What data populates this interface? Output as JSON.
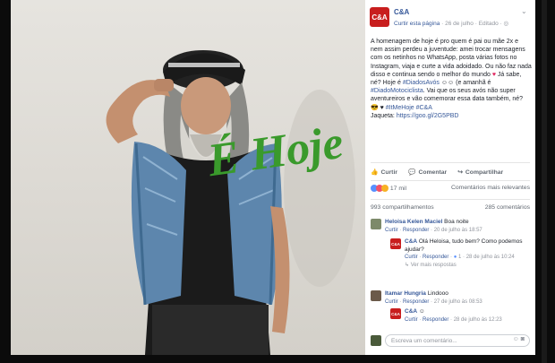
{
  "page": {
    "name": "C&A",
    "logo_text": "C&A",
    "follow_label": "Curtir esta página",
    "date": "26 de julho",
    "edited": "Editado",
    "globe_icon": "globe-icon"
  },
  "photo": {
    "overlay_text": "É Hoje",
    "overlay_color": "#3a9a2c"
  },
  "post": {
    "text_1": "A homenagem de hoje é pro quem é pai ou mãe 2x e nem assim perdeu a juventude: amei trocar mensagens com os netinhos no WhatsApp, posta várias fotos no Instagram, viaja e curte a vida adoidado. Ou não faz nada disso e continua sendo o melhor do mundo ",
    "text_2": " Já sabe, né? Hoje é ",
    "hashtag_1": "#DiadosAvós",
    "text_3": " (e amanhã é ",
    "hashtag_2": "#DiadoMotociclista",
    "text_4": ". Vai que os seus avós não super aventureiros e vão comemorar essa data também, né?",
    "hashtag_3": "#ItMeHoje #C&A",
    "jacket_label": "Jaqueta: ",
    "jacket_link": "https://goo.gl/2G5PBD"
  },
  "actions": {
    "like": "Curtir",
    "comment": "Comentar",
    "share": "Compartilhar"
  },
  "reactions": {
    "count": "17 mil",
    "sort_label": "Comentários mais relevantes",
    "shares": "993 compartilhamentos",
    "comments": "285 comentários"
  },
  "comments": [
    {
      "author": "Heloisa Kelen Maciel",
      "text": "Boa noite",
      "like": "Curtir",
      "reply": "Responder",
      "time": "20 de julho às 18:57"
    },
    {
      "author": "C&A",
      "text": "Olá Heloisa, tudo bem? Como podemos ajudar?",
      "like": "Curtir",
      "reply": "Responder",
      "likes": "1",
      "time": "28 de julho às 10:24",
      "more": "Ver mais respostas"
    },
    {
      "author": "Itamar Hungria",
      "text": "Lindooo",
      "like": "Curtir",
      "reply": "Responder",
      "time": "27 de julho às 08:53"
    },
    {
      "author": "C&A",
      "text": "",
      "like": "Curtir",
      "reply": "Responder",
      "time": "28 de julho às 12:23"
    }
  ],
  "composer": {
    "placeholder": "Escreva um comentário..."
  }
}
